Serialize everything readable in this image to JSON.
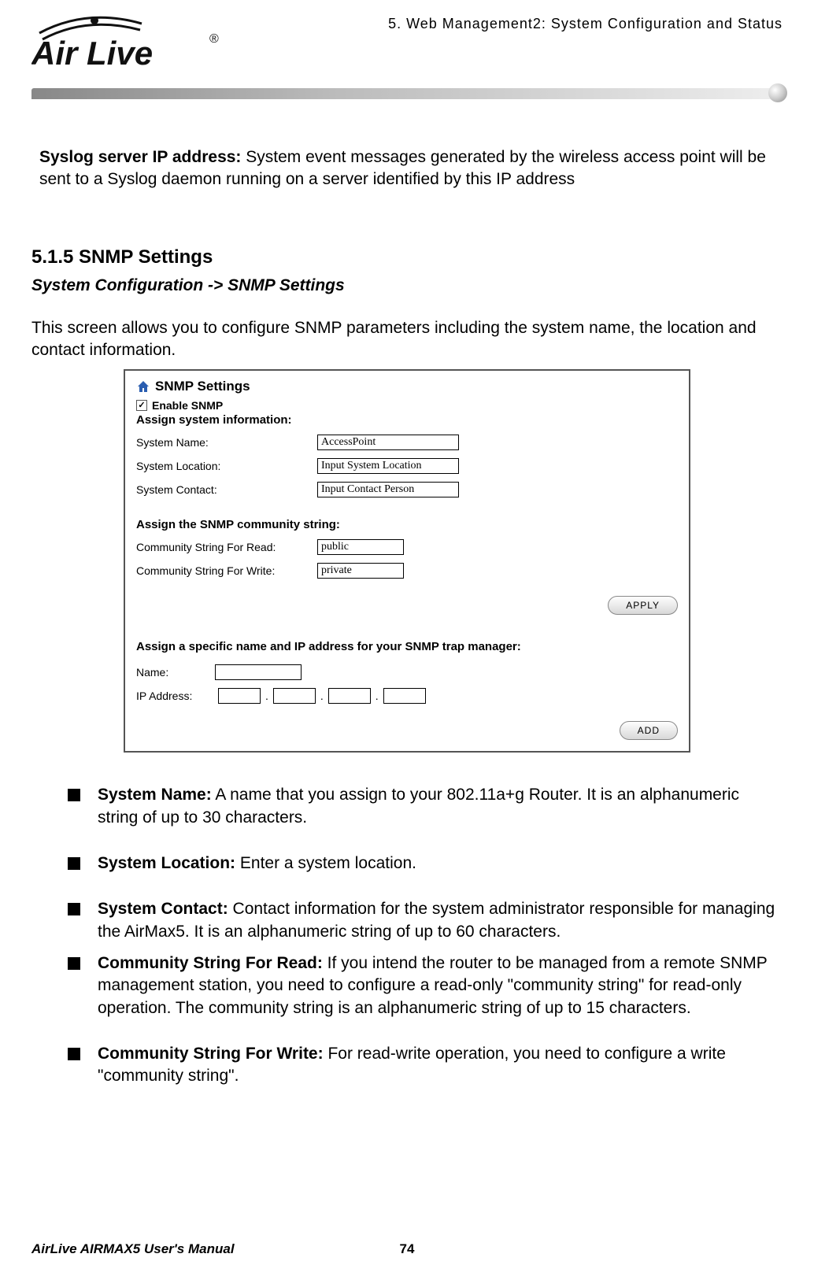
{
  "header": {
    "logo_brand": "Air Live",
    "registered_mark": "®",
    "chapter_ref": "5.  Web Management2: System Configuration and Status"
  },
  "syslog": {
    "label": "Syslog server IP address:",
    "text": " System event messages generated by the wireless access point will be sent to a Syslog daemon running on a server identified by this IP address"
  },
  "section": {
    "number_title": "5.1.5 SNMP Settings",
    "breadcrumb": "System Configuration -> SNMP Settings",
    "intro": "This screen allows you to configure SNMP parameters including the system name, the location and contact information."
  },
  "snmp_panel": {
    "title": "SNMP Settings",
    "enable_checked": true,
    "enable_label": "Enable SNMP",
    "assign_info_head": "Assign system information:",
    "system_name_label": "System Name:",
    "system_name_value": "AccessPoint",
    "system_location_label": "System Location:",
    "system_location_value": "Input System Location",
    "system_contact_label": "System Contact:",
    "system_contact_value": "Input Contact Person",
    "community_head": "Assign the SNMP community string:",
    "community_read_label": "Community String For Read:",
    "community_read_value": "public",
    "community_write_label": "Community String For Write:",
    "community_write_value": "private",
    "apply_label": "APPLY",
    "trap_head": "Assign a specific name and IP address for your SNMP trap manager:",
    "trap_name_label": "Name:",
    "trap_name_value": "",
    "trap_ip_label": "IP Address:",
    "ip1": "",
    "ip2": "",
    "ip3": "",
    "ip4": "",
    "add_label": "ADD"
  },
  "bullets": {
    "b1_label": "System Name:",
    "b1_text": " A name that you assign to your 802.11a+g Router. It is an alphanumeric string of up to 30 characters.",
    "b2_label": "System Location:",
    "b2_text": " Enter a system location.",
    "b3_label": "System Contact:",
    "b3_text": " Contact information for the system administrator responsible for managing the AirMax5. It is an alphanumeric string of up to 60 characters.",
    "b4_label": "Community String For Read:",
    "b4_text": " If you intend the router to be managed from a remote SNMP management station, you need to configure a read-only \"community string\" for read-only operation. The community string is an alphanumeric string of up to 15 characters.",
    "b5_label": "Community String For Write:",
    "b5_text": " For read-write operation, you need to configure a write \"community string\"."
  },
  "footer": {
    "manual": "AirLive AIRMAX5 User's Manual",
    "page": "74"
  }
}
